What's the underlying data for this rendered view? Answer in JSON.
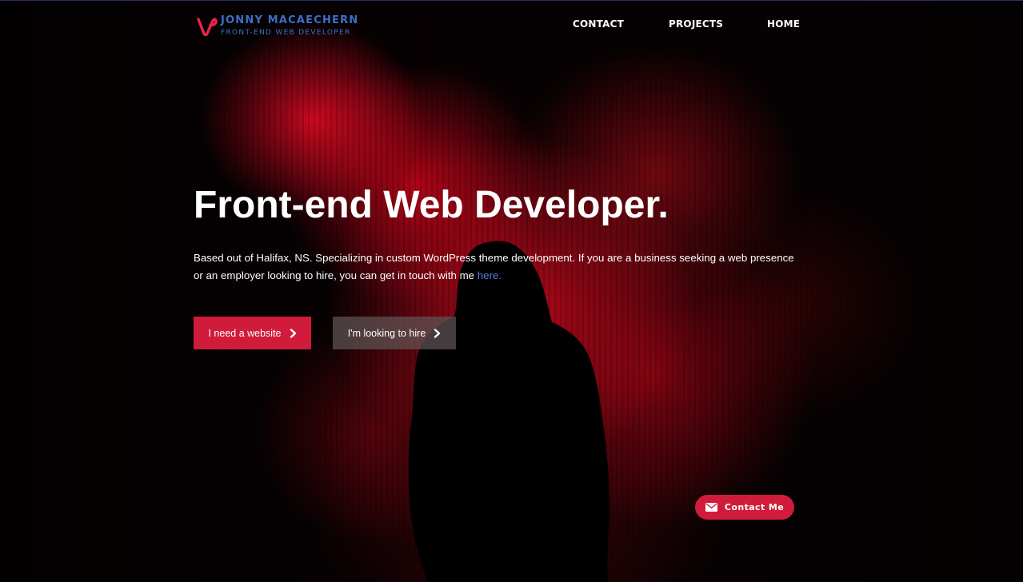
{
  "brand": {
    "name": "JONNY MACAECHERN",
    "tagline": "FRONT-END WEB DEVELOPER",
    "logo_icon": "vine-v-logo",
    "logo_color": "#e8254a",
    "text_color": "#3d6fc6"
  },
  "nav": {
    "items": [
      {
        "label": "CONTACT"
      },
      {
        "label": "PROJECTS"
      },
      {
        "label": "HOME"
      }
    ]
  },
  "hero": {
    "headline": "Front-end Web Developer.",
    "intro_text": "Based out of Halifax, NS. Specializing in custom WordPress theme development. If you are a business seeking a web presence or an employer looking to hire, you can get in touch with me ",
    "intro_link": "here.",
    "primary_button": {
      "label": "I need a website",
      "icon": "chevron-right-icon",
      "color": "#d01c3a"
    },
    "secondary_button": {
      "label": "I'm looking to hire",
      "icon": "chevron-right-icon"
    }
  },
  "contact_widget": {
    "label": "Contact Me",
    "icon": "envelope-icon",
    "color": "#d01c3a"
  },
  "colors": {
    "accent": "#d01c3a",
    "link": "#5a7fd6",
    "background": "#050001"
  }
}
